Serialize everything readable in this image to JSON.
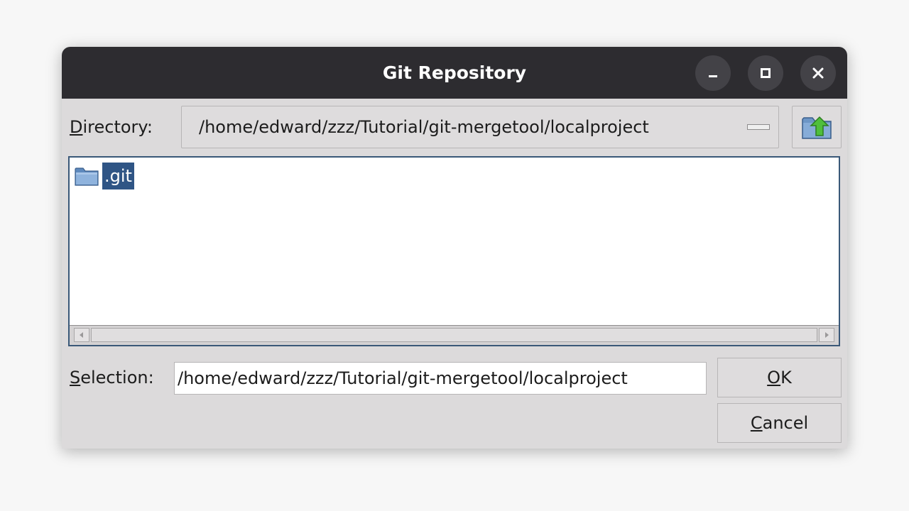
{
  "window": {
    "title": "Git Repository"
  },
  "directory": {
    "label_mnemonic": "D",
    "label_rest": "irectory:",
    "path": "/home/edward/zzz/Tutorial/git-mergetool/localproject"
  },
  "file_list": {
    "items": [
      {
        "name": ".git",
        "type": "folder",
        "selected": true
      }
    ]
  },
  "selection": {
    "label_mnemonic": "S",
    "label_rest": "election:",
    "value": "/home/edward/zzz/Tutorial/git-mergetool/localproject"
  },
  "buttons": {
    "ok_mnemonic": "O",
    "ok_rest": "K",
    "cancel_mnemonic": "C",
    "cancel_rest": "ancel"
  },
  "colors": {
    "titlebar": "#2d2c30",
    "selection_highlight": "#2f5585",
    "dialog_background": "#dcdadb"
  },
  "icons": {
    "minimize": "minimize-icon",
    "maximize": "maximize-icon",
    "close": "close-icon",
    "up_folder": "folder-up-icon",
    "folder": "folder-icon"
  }
}
